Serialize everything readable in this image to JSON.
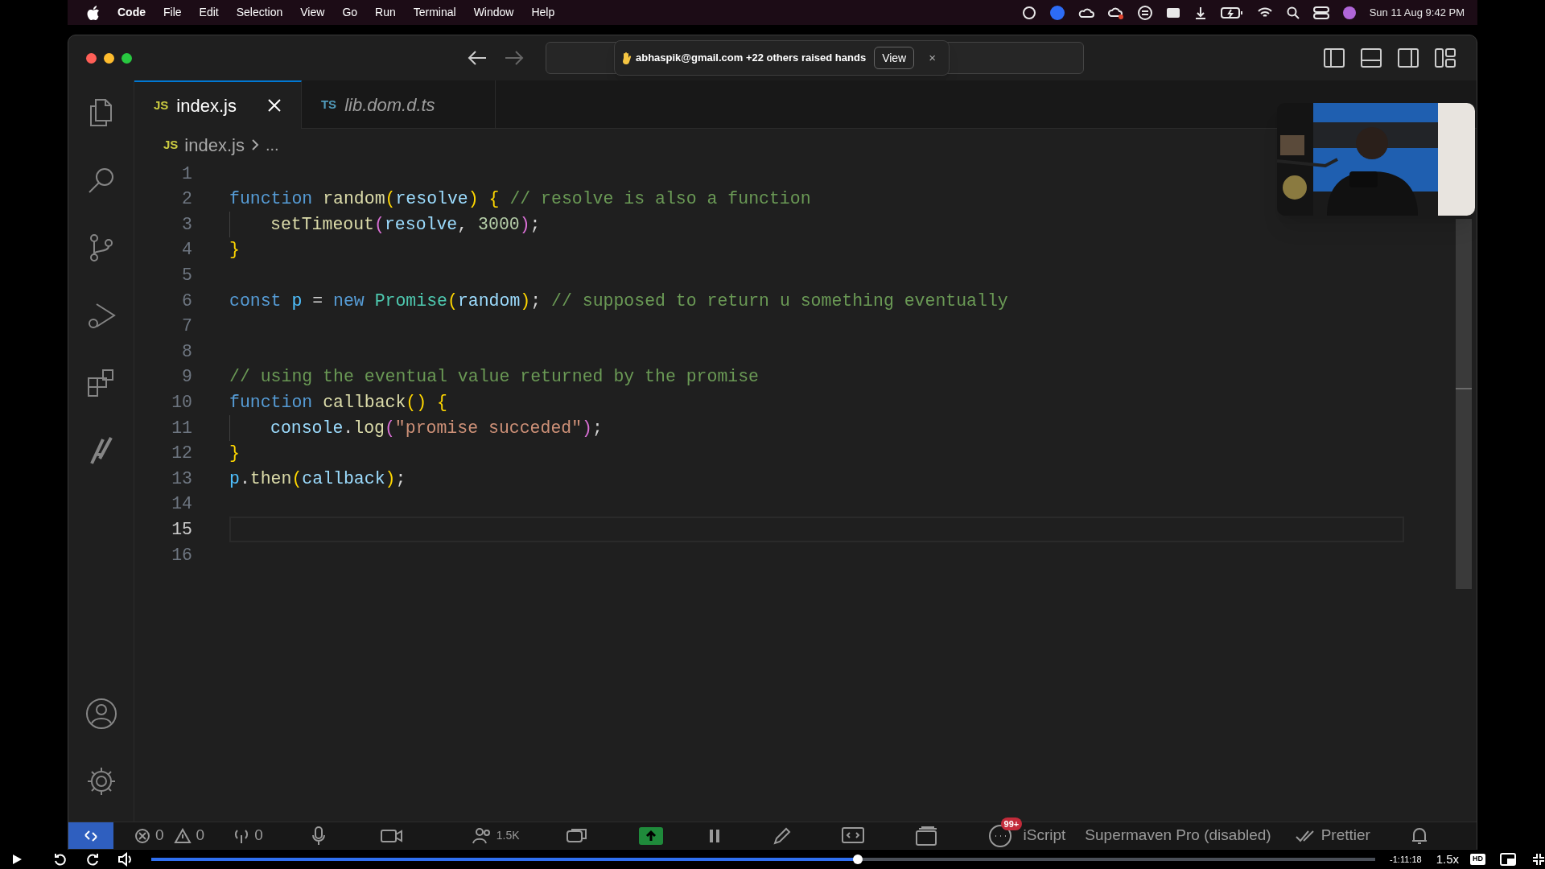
{
  "menu_bar": {
    "app": "Code",
    "menus": [
      "File",
      "Edit",
      "Selection",
      "View",
      "Go",
      "Run",
      "Terminal",
      "Window",
      "Help"
    ],
    "clock": "Sun 11 Aug 9:42 PM"
  },
  "notification": {
    "text": "abhaspik@gmail.com +22 others raised hands",
    "button": "View",
    "close": "×"
  },
  "tabs": [
    {
      "badge": "JS",
      "kind": "js",
      "label": "index.js",
      "selected": true,
      "preview": false
    },
    {
      "badge": "TS",
      "kind": "ts",
      "label": "lib.dom.d.ts",
      "selected": false,
      "preview": true
    }
  ],
  "breadcrumb": {
    "badge": "JS",
    "kind": "js",
    "file": "index.js",
    "more": "..."
  },
  "editor": {
    "lines": [
      {
        "number": "1",
        "current": false,
        "indented": false
      },
      {
        "number": "2",
        "current": false,
        "indented": false,
        "tokens": [
          {
            "t": "function ",
            "color": "#569cd6"
          },
          {
            "t": "random",
            "color": "#dcdcaa"
          },
          {
            "t": "(",
            "color": "#ffd700"
          },
          {
            "t": "resolve",
            "color": "#9cdcfe"
          },
          {
            "t": ") {",
            "color": "#ffd700"
          },
          {
            "t": " // resolve is also a function",
            "color": "#6a9955"
          }
        ]
      },
      {
        "number": "3",
        "current": false,
        "indented": true,
        "tokens": [
          {
            "t": "setTimeout",
            "color": "#dcdcaa"
          },
          {
            "t": "(",
            "color": "#da70d6"
          },
          {
            "t": "resolve",
            "color": "#9cdcfe"
          },
          {
            "t": ", ",
            "color": "#d4d4d4"
          },
          {
            "t": "3000",
            "color": "#b5cea8"
          },
          {
            "t": ")",
            "color": "#da70d6"
          },
          {
            "t": ";",
            "color": "#d4d4d4"
          }
        ]
      },
      {
        "number": "4",
        "current": false,
        "indented": false,
        "tokens": [
          {
            "t": "}",
            "color": "#ffd700"
          }
        ]
      },
      {
        "number": "5",
        "current": false,
        "indented": false
      },
      {
        "number": "6",
        "current": false,
        "indented": false,
        "tokens": [
          {
            "t": "const ",
            "color": "#569cd6"
          },
          {
            "t": "p",
            "color": "#4fc1ff"
          },
          {
            "t": " = ",
            "color": "#d4d4d4"
          },
          {
            "t": "new ",
            "color": "#569cd6"
          },
          {
            "t": "Promise",
            "color": "#4ec9b0"
          },
          {
            "t": "(",
            "color": "#ffd700"
          },
          {
            "t": "random",
            "color": "#9cdcfe"
          },
          {
            "t": ")",
            "color": "#ffd700"
          },
          {
            "t": "; ",
            "color": "#d4d4d4"
          },
          {
            "t": "// supposed to return u something eventually",
            "color": "#6a9955"
          }
        ]
      },
      {
        "number": "7",
        "current": false,
        "indented": false
      },
      {
        "number": "8",
        "current": false,
        "indented": false
      },
      {
        "number": "9",
        "current": false,
        "indented": false,
        "tokens": [
          {
            "t": "// using the eventual value returned by the promise",
            "color": "#6a9955"
          }
        ]
      },
      {
        "number": "10",
        "current": false,
        "indented": false,
        "tokens": [
          {
            "t": "function ",
            "color": "#569cd6"
          },
          {
            "t": "callback",
            "color": "#dcdcaa"
          },
          {
            "t": "() {",
            "color": "#ffd700"
          }
        ]
      },
      {
        "number": "11",
        "current": false,
        "indented": true,
        "tokens": [
          {
            "t": "console",
            "color": "#9cdcfe"
          },
          {
            "t": ".",
            "color": "#d4d4d4"
          },
          {
            "t": "log",
            "color": "#dcdcaa"
          },
          {
            "t": "(",
            "color": "#da70d6"
          },
          {
            "t": "\"promise succeded\"",
            "color": "#ce9178"
          },
          {
            "t": ")",
            "color": "#da70d6"
          },
          {
            "t": ";",
            "color": "#d4d4d4"
          }
        ]
      },
      {
        "number": "12",
        "current": false,
        "indented": false,
        "tokens": [
          {
            "t": "}",
            "color": "#ffd700"
          }
        ]
      },
      {
        "number": "13",
        "current": false,
        "indented": false,
        "tokens": [
          {
            "t": "p",
            "color": "#4fc1ff"
          },
          {
            "t": ".",
            "color": "#d4d4d4"
          },
          {
            "t": "then",
            "color": "#dcdcaa"
          },
          {
            "t": "(",
            "color": "#ffd700"
          },
          {
            "t": "callback",
            "color": "#9cdcfe"
          },
          {
            "t": ")",
            "color": "#ffd700"
          },
          {
            "t": ";",
            "color": "#d4d4d4"
          }
        ]
      },
      {
        "number": "14",
        "current": false,
        "indented": false
      },
      {
        "number": "15",
        "current": true,
        "indented": false
      },
      {
        "number": "16",
        "current": false,
        "indented": false
      }
    ]
  },
  "status_bar": {
    "errors": "0",
    "warnings": "0",
    "ports": "0",
    "participants": "1.5K",
    "more_badge": "99+",
    "language": "iScript",
    "items": [
      "Supermaven Pro (disabled)",
      "Prettier"
    ]
  },
  "video_player": {
    "remaining": "-1:11:18",
    "speed": "1.5x",
    "quality": "HD",
    "level": 0.577
  }
}
